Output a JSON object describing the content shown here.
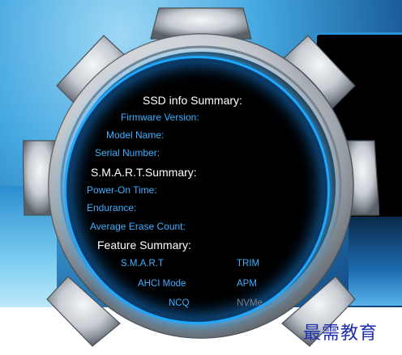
{
  "colors": {
    "header_text": "#ffffff",
    "label_text": "#3fb0ff",
    "disabled_text": "#7f7f7f",
    "ring_glow": "#1ea7ff",
    "watermark": "#1c2fa8"
  },
  "ssd_info": {
    "title": "SSD info Summary:",
    "firmware_label": "Firmware Version:",
    "model_label": "Model Name:",
    "serial_label": "Serial Number:"
  },
  "smart": {
    "title": "S.M.A.R.T.Summary:",
    "power_on_label": "Power-On Time:",
    "endurance_label": "Endurance:",
    "erase_label": "Average Erase Count:"
  },
  "features": {
    "title": "Feature Summary:",
    "items": [
      {
        "label": "S.M.A.R.T",
        "enabled": true
      },
      {
        "label": "TRIM",
        "enabled": true
      },
      {
        "label": "AHCI Mode",
        "enabled": true
      },
      {
        "label": "APM",
        "enabled": true
      },
      {
        "label": "NCQ",
        "enabled": true
      },
      {
        "label": "NVMe",
        "enabled": false
      }
    ]
  },
  "watermark": "最需教育"
}
